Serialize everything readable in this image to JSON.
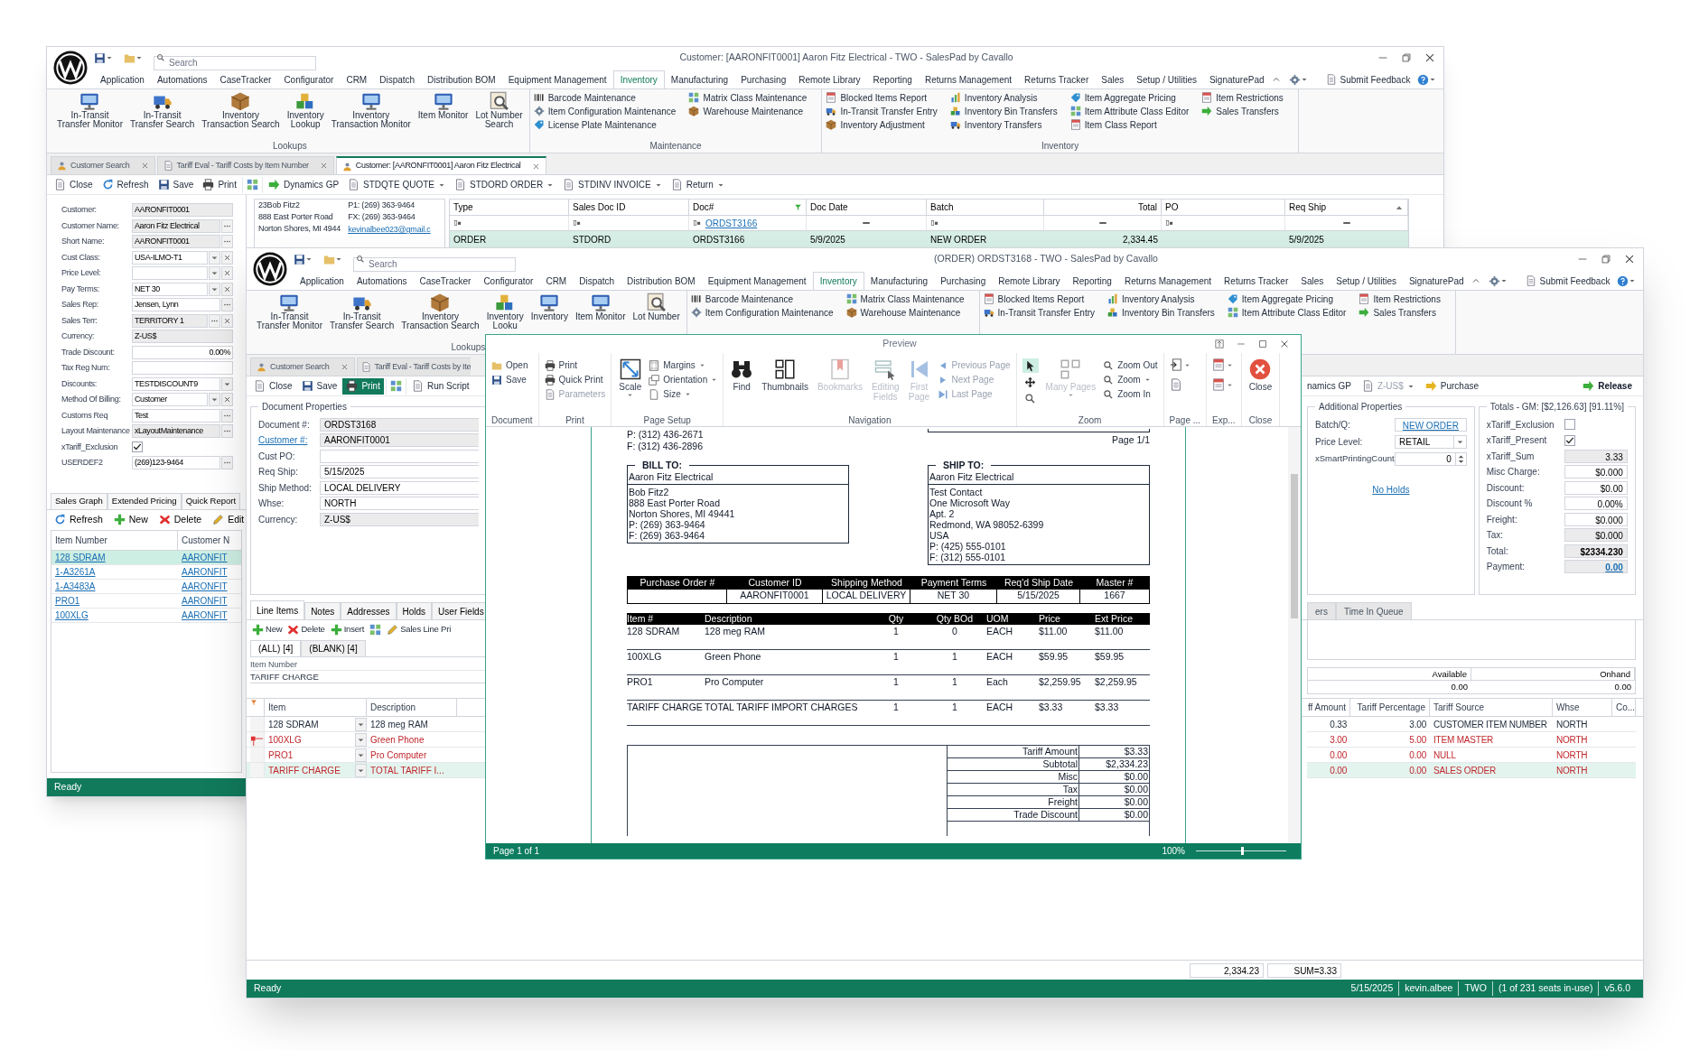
{
  "back_window": {
    "title": "Customer: [AARONFIT0001] Aaron Fitz Electrical - TWO - SalesPad by Cavallo",
    "search": {
      "placeholder": "Search"
    },
    "menu": [
      {
        "label": "Application",
        "selected": false
      },
      {
        "label": "Automations",
        "selected": false
      },
      {
        "label": "CaseTracker",
        "selected": false
      },
      {
        "label": "Configurator",
        "selected": false
      },
      {
        "label": "CRM",
        "selected": false
      },
      {
        "label": "Dispatch",
        "selected": false
      },
      {
        "label": "Distribution BOM",
        "selected": false
      },
      {
        "label": "Equipment Management",
        "selected": false
      },
      {
        "label": "Inventory",
        "selected": true
      },
      {
        "label": "Manufacturing",
        "selected": false
      },
      {
        "label": "Purchasing",
        "selected": false
      },
      {
        "label": "Remote Library",
        "selected": false
      },
      {
        "label": "Reporting",
        "selected": false
      },
      {
        "label": "Returns Management",
        "selected": false
      },
      {
        "label": "Returns Tracker",
        "selected": false
      },
      {
        "label": "Sales",
        "selected": false
      },
      {
        "label": "Setup / Utilities",
        "selected": false
      },
      {
        "label": "SignaturePad",
        "selected": false
      }
    ],
    "feedback": "Submit Feedback",
    "ribbon": [
      {
        "kind": "large",
        "label": "Lookups",
        "buttons": [
          [
            "In-Transit",
            "Transfer Monitor"
          ],
          [
            "In-Transit",
            "Transfer Search"
          ],
          [
            "Inventory",
            "Transaction Search"
          ],
          [
            "Inventory",
            "Lookup"
          ],
          [
            "Inventory",
            "Transaction Monitor"
          ],
          [
            "Item Monitor"
          ],
          [
            "Lot Number",
            "Search"
          ]
        ]
      },
      {
        "kind": "small",
        "label": "Maintenance",
        "columns": [
          [
            "Barcode Maintenance",
            "Item Configuration Maintenance",
            "License Plate Maintenance"
          ],
          [
            "Matrix Class Maintenance",
            "Warehouse Maintenance"
          ]
        ]
      },
      {
        "kind": "small",
        "label": "Inventory",
        "columns": [
          [
            "Blocked Items Report",
            "In-Transit Transfer Entry",
            "Inventory Adjustment"
          ],
          [
            "Inventory Analysis",
            "Inventory Bin Transfers",
            "Inventory Transfers"
          ],
          [
            "Item Aggregate Pricing",
            "Item Attribute Class Editor",
            "Item Class Report"
          ],
          [
            "Item Restrictions",
            "Sales Transfers"
          ]
        ]
      }
    ],
    "doc_tabs": [
      {
        "label": "Customer Search",
        "selected": false
      },
      {
        "label": "Tariff Eval - Tariff Costs by Item Number",
        "selected": false
      },
      {
        "label": "Customer: [AARONFIT0001] Aaron Fitz Electrical",
        "selected": true
      }
    ],
    "toolbar": {
      "left": [
        {
          "label": "Close",
          "kind": "button"
        },
        {
          "label": "Refresh",
          "kind": "button"
        },
        {
          "label": "Save",
          "kind": "button"
        },
        {
          "label": "Print",
          "kind": "button"
        },
        {
          "kind": "icon"
        },
        {
          "label": "Dynamics GP",
          "kind": "button"
        },
        {
          "label": "STDQTE QUOTE",
          "kind": "dropdown"
        },
        {
          "label": "STDORD ORDER",
          "kind": "dropdown"
        },
        {
          "label": "STDINV INVOICE",
          "kind": "dropdown"
        },
        {
          "label": "Return",
          "kind": "dropdown"
        }
      ]
    },
    "customer_form": [
      {
        "label": "Customer:",
        "value": "AARONFIT0001",
        "kind": "text",
        "readonly": true
      },
      {
        "label": "Customer Name:",
        "value": "Aaron Fitz Electrical",
        "kind": "lookup",
        "readonly": true
      },
      {
        "label": "Short Name:",
        "value": "AARONFIT0001",
        "kind": "lookup",
        "readonly": true
      },
      {
        "label": "Cust Class:",
        "value": "USA-ILMO-T1",
        "kind": "combo_clear",
        "readonly": false
      },
      {
        "label": "Price Level:",
        "kind": "combo_clear",
        "readonly": false
      },
      {
        "label": "Pay Terms:",
        "value": "NET 30",
        "kind": "combo_clear",
        "readonly": false
      },
      {
        "label": "Sales Rep:",
        "value": "Jensen, Lynn",
        "kind": "lookup",
        "readonly": false
      },
      {
        "label": "Sales Terr:",
        "value": "TERRITORY 1",
        "kind": "lookup_clear",
        "readonly": true
      },
      {
        "label": "Currency:",
        "value": "Z-US$",
        "kind": "text",
        "readonly": true
      },
      {
        "label": "Trade Discount:",
        "value": "0.00%",
        "kind": "number",
        "readonly": false
      },
      {
        "label": "Tax Reg Num:",
        "kind": "text",
        "readonly": false
      },
      {
        "label": "Discounts:",
        "value": "TESTDISCOUNT9",
        "kind": "combo",
        "readonly": false
      },
      {
        "label": "Method Of Billing:",
        "value": "Customer",
        "kind": "combo_clear",
        "readonly": false
      },
      {
        "label": "Customs Req",
        "value": "Test",
        "kind": "lookup",
        "readonly": false
      },
      {
        "label": "Layout Maintenance",
        "value": "xLayoutMaintenance",
        "kind": "lookup",
        "readonly": true
      },
      {
        "label": "xTariff_Exclusion",
        "kind": "checkbox",
        "checked": true
      },
      {
        "label": "USERDEF2",
        "value": "(269)123-9464",
        "kind": "lookup",
        "readonly": false
      }
    ],
    "address": {
      "lines": [
        "23Bob Fitz2",
        "888 East Porter Road",
        "Norton Shores, MI 4944"
      ],
      "phones": [
        "P1: (269) 363-9464",
        "FX: (269) 363-9464"
      ],
      "email": "kevinalbee023@gmail.c"
    },
    "orders_grid": {
      "columns": [
        "Type",
        "Sales Doc ID",
        "Doc#",
        "Doc Date",
        "Batch",
        "Total",
        "PO",
        "Req Ship"
      ],
      "filters": [
        {
          "kind": "contains"
        },
        {
          "kind": "contains"
        },
        {
          "kind": "contains",
          "value": "ORDST3166"
        },
        {
          "kind": "equals"
        },
        {
          "kind": "contains"
        },
        {
          "kind": "equals"
        },
        {
          "kind": "contains"
        },
        {
          "kind": "equals"
        }
      ],
      "rows": [
        {
          "type": "ORDER",
          "sales_doc_id": "STDORD",
          "doc": "ORDST3166",
          "doc_date": "5/9/2025",
          "batch": "NEW ORDER",
          "total": "2,334.45",
          "req_ship": "5/9/2025",
          "selected": true
        }
      ]
    },
    "side_tabs": [
      "Sales Graph",
      "Extended Pricing",
      "Quick Report"
    ],
    "side_toolbar": [
      "Refresh",
      "New",
      "Delete",
      "Edit"
    ],
    "item_list": {
      "columns": [
        "Item Number",
        "Customer N"
      ],
      "rows": [
        {
          "item": "128 SDRAM",
          "customer": "AARONFIT",
          "selected": true
        },
        {
          "item": "1-A3261A",
          "customer": "AARONFIT",
          "selected": false
        },
        {
          "item": "1-A3483A",
          "customer": "AARONFIT",
          "selected": false
        },
        {
          "item": "PRO1",
          "customer": "AARONFIT",
          "selected": false
        },
        {
          "item": "100XLG",
          "customer": "AARONFIT",
          "selected": false
        }
      ]
    },
    "status": "Ready"
  },
  "main_window": {
    "title": "(ORDER) ORDST3168 - TWO - SalesPad by Cavallo",
    "search": {
      "placeholder": "Search"
    },
    "menu": [
      {
        "label": "Application",
        "selected": false
      },
      {
        "label": "Automations",
        "selected": false
      },
      {
        "label": "CaseTracker",
        "selected": false
      },
      {
        "label": "Configurator",
        "selected": false
      },
      {
        "label": "CRM",
        "selected": false
      },
      {
        "label": "Dispatch",
        "selected": false
      },
      {
        "label": "Distribution BOM",
        "selected": false
      },
      {
        "label": "Equipment Management",
        "selected": false
      },
      {
        "label": "Inventory",
        "selected": true
      },
      {
        "label": "Manufacturing",
        "selected": false
      },
      {
        "label": "Purchasing",
        "selected": false
      },
      {
        "label": "Remote Library",
        "selected": false
      },
      {
        "label": "Reporting",
        "selected": false
      },
      {
        "label": "Returns Management",
        "selected": false
      },
      {
        "label": "Returns Tracker",
        "selected": false
      },
      {
        "label": "Sales",
        "selected": false
      },
      {
        "label": "Setup / Utilities",
        "selected": false
      },
      {
        "label": "SignaturePad",
        "selected": false
      }
    ],
    "feedback": "Submit Feedback",
    "ribbon": [
      {
        "kind": "large",
        "label": "Lookups",
        "buttons": [
          [
            "In-Transit",
            "Transfer Monitor"
          ],
          [
            "In-Transit",
            "Transfer Search"
          ],
          [
            "Inventory",
            "Transaction Search"
          ],
          [
            "Inventory",
            "Looku"
          ],
          [
            "Inventory"
          ],
          [
            "Item Monitor"
          ],
          [
            "Lot Number"
          ]
        ]
      },
      {
        "kind": "small",
        "columns": [
          [
            "Barcode Maintenance",
            "Item Configuration Maintenance"
          ],
          [
            "Matrix Class Maintenance",
            "Warehouse Maintenance"
          ]
        ]
      },
      {
        "kind": "small",
        "columns": [
          [
            "Blocked Items Report",
            "In-Transit Transfer Entry"
          ],
          [
            "Inventory Analysis",
            "Inventory Bin Transfers"
          ],
          [
            "Item Aggregate Pricing",
            "Item Attribute Class Editor"
          ],
          [
            "Item Restrictions",
            "Sales Transfers"
          ]
        ]
      }
    ],
    "doc_tabs": [
      {
        "label": "Customer Search",
        "selected": false
      },
      {
        "label": "Tariff Eval - Tariff Costs by Ite",
        "selected": false
      }
    ],
    "toolbar": {
      "left": [
        {
          "label": "Close",
          "kind": "button"
        },
        {
          "label": "Save",
          "kind": "button"
        },
        {
          "label": "Print",
          "kind": "primary"
        },
        {
          "kind": "icon"
        },
        {
          "label": "Run Script",
          "kind": "button"
        }
      ],
      "right": [
        {
          "label": "namics GP",
          "kind": "plain"
        },
        {
          "label": "Z-US$",
          "kind": "disabled_dropdown"
        },
        {
          "label": "Purchase",
          "kind": "button"
        },
        {
          "label": "Release",
          "kind": "strong"
        }
      ]
    },
    "doc_properties": {
      "title": "Document Properties",
      "fields": [
        {
          "label": "Document #:",
          "value": "ORDST3168",
          "readonly": true,
          "link": false
        },
        {
          "label": "Customer #:",
          "value": "AARONFIT0001",
          "readonly": true,
          "link": true
        },
        {
          "label": "Cust PO:",
          "readonly": false,
          "link": false
        },
        {
          "label": "Req Ship:",
          "value": "5/15/2025",
          "readonly": false,
          "link": false
        },
        {
          "label": "Ship Method:",
          "value": "LOCAL DELIVERY",
          "readonly": false,
          "link": false
        },
        {
          "label": "Whse:",
          "value": "NORTH",
          "readonly": false,
          "link": false
        },
        {
          "label": "Currency:",
          "value": "Z-US$",
          "readonly": true,
          "link": false
        }
      ]
    },
    "additional_properties": {
      "title": "Additional Properties",
      "batch": {
        "label": "Batch/Q:",
        "value": "NEW ORDER"
      },
      "price_level": {
        "label": "Price Level:",
        "value": "RETAIL"
      },
      "printing_count": {
        "label": "xSmartPrintingCount",
        "value": "0"
      },
      "holds": "No Holds"
    },
    "totals": {
      "title": "Totals - GM: [$2,126.63] [91.11%]",
      "rows": [
        {
          "label": "xTariff_Exclusion",
          "kind": "checkbox",
          "checked": false
        },
        {
          "label": "xTariff_Present",
          "kind": "checkbox",
          "checked": true
        },
        {
          "label": "xTariff_Sum",
          "value": "3.33",
          "kind": "readonly"
        },
        {
          "label": "Misc Charge:",
          "value": "$0.000",
          "kind": "input"
        },
        {
          "label": "Discount:",
          "value": "$0.00",
          "kind": "input"
        },
        {
          "label": "Discount %",
          "value": "0.00%",
          "kind": "input"
        },
        {
          "label": "Freight:",
          "value": "$0.000",
          "kind": "input"
        },
        {
          "label": "Tax:",
          "value": "$0.000",
          "kind": "readonly"
        },
        {
          "label": "Total:",
          "value": "$2334.230",
          "kind": "total"
        },
        {
          "label": "Payment:",
          "value": "0.00",
          "kind": "link"
        }
      ]
    },
    "line_tabs": {
      "left": [
        {
          "label": "Line Items",
          "selected": true
        },
        {
          "label": "Notes",
          "selected": false
        },
        {
          "label": "Addresses",
          "selected": false
        },
        {
          "label": "Holds",
          "selected": false
        },
        {
          "label": "User Fields",
          "selected": false
        }
      ],
      "right": [
        {
          "label": "ers",
          "selected": false
        },
        {
          "label": "Time In Queue",
          "selected": false
        }
      ]
    },
    "line_toolbar": [
      {
        "label": "New",
        "kind": "button"
      },
      {
        "label": "Delete",
        "kind": "button"
      },
      {
        "label": "Insert",
        "kind": "button"
      },
      {
        "kind": "icon"
      },
      {
        "label": "Sales Line Pri",
        "kind": "button"
      }
    ],
    "filter_tabs": [
      {
        "label": "(ALL) [4]",
        "selected": true
      },
      {
        "label": "(BLANK) [4]",
        "selected": false
      }
    ],
    "item_number": {
      "label": "Item Number",
      "value": "TARIFF CHARGE"
    },
    "availability": {
      "columns": [
        "Available",
        "Onhand"
      ],
      "values": [
        "0.00",
        "0.00"
      ]
    },
    "lines": {
      "columns_left": [
        "Item",
        "Description"
      ],
      "columns_right": [
        "ff Amount",
        "Tariff Percentage",
        "Tariff Source",
        "Whse",
        "Co..."
      ],
      "rows": [
        {
          "item": "128 SDRAM",
          "description": "128 meg RAM",
          "tariff_amount": "0.33",
          "tariff_percentage": "3.00",
          "tariff_source": "CUSTOMER ITEM NUMBER",
          "whse": "NORTH",
          "flagged": false,
          "focused": false,
          "selected": false
        },
        {
          "item": "100XLG",
          "description": "Green Phone",
          "tariff_amount": "3.00",
          "tariff_percentage": "5.00",
          "tariff_source": "ITEM MASTER",
          "whse": "NORTH",
          "flagged": true,
          "focused": true,
          "selected": false
        },
        {
          "item": "PRO1",
          "description": "Pro Computer",
          "tariff_amount": "0.00",
          "tariff_percentage": "0.00",
          "tariff_source": "NULL",
          "whse": "NORTH",
          "flagged": true,
          "focused": false,
          "selected": false
        },
        {
          "item": "TARIFF CHARGE",
          "description": "TOTAL TARIFF I...",
          "tariff_amount": "0.00",
          "tariff_percentage": "0.00",
          "tariff_source": "SALES ORDER",
          "whse": "NORTH",
          "flagged": true,
          "focused": false,
          "selected": true
        }
      ]
    },
    "summary": [
      "2,334.23",
      "SUM=3.33"
    ],
    "status": {
      "left": "Ready",
      "right": [
        "5/15/2025",
        "kevin.albee",
        "TWO",
        "(1 of 231 seats in-use)",
        "v5.6.0"
      ]
    }
  },
  "preview": {
    "title": "Preview",
    "ribbon": [
      {
        "label": "Document",
        "items": [
          {
            "label": "Open",
            "disabled": false,
            "dropdown": false
          },
          {
            "label": "Save",
            "disabled": false,
            "dropdown": false
          }
        ]
      },
      {
        "label": "Print",
        "items": [
          {
            "label": "Print",
            "disabled": false,
            "dropdown": false
          },
          {
            "label": "Quick Print",
            "disabled": false,
            "dropdown": false
          },
          {
            "label": "Parameters",
            "disabled": true,
            "dropdown": false
          }
        ]
      },
      {
        "label": "Page Setup",
        "large": [
          {
            "lines": [
              "Scale"
            ],
            "disabled": false,
            "dropdown": true
          }
        ],
        "items": [
          {
            "label": "Margins",
            "disabled": false,
            "dropdown": true
          },
          {
            "label": "Orientation",
            "disabled": false,
            "dropdown": true
          },
          {
            "label": "Size",
            "disabled": false,
            "dropdown": true
          }
        ]
      },
      {
        "label": "Navigation",
        "large": [
          {
            "lines": [
              "Find"
            ],
            "disabled": false,
            "dropdown": false
          },
          {
            "lines": [
              "Thumbnails"
            ],
            "disabled": false,
            "dropdown": false
          },
          {
            "lines": [
              "Bookmarks"
            ],
            "disabled": true,
            "dropdown": false
          },
          {
            "lines": [
              "Editing",
              "Fields"
            ],
            "disabled": true,
            "dropdown": false
          },
          {
            "lines": [
              "First",
              "Page"
            ],
            "disabled": true,
            "dropdown": false
          }
        ],
        "items": [
          {
            "label": "Previous Page",
            "disabled": true,
            "dropdown": false
          },
          {
            "label": "Next Page",
            "disabled": true,
            "dropdown": false
          },
          {
            "label": "Last Page",
            "disabled": true,
            "dropdown": false
          }
        ]
      },
      {
        "label": "Zoom",
        "tools": [
          {
            "selected": true
          },
          {
            "selected": false
          },
          {
            "selected": false
          }
        ],
        "large": [
          {
            "lines": [
              "Many Pages"
            ],
            "disabled": true,
            "dropdown": true
          }
        ],
        "items": [
          {
            "label": "Zoom Out",
            "disabled": false,
            "dropdown": false
          },
          {
            "label": "Zoom",
            "disabled": false,
            "dropdown": true
          },
          {
            "label": "Zoom In",
            "disabled": false,
            "dropdown": false
          }
        ]
      },
      {
        "label": "Page ...",
        "icon_buttons": [
          {
            "dropdown": true
          },
          {
            "dropdown": false
          }
        ]
      },
      {
        "label": "Exp...",
        "icon_buttons": [
          {
            "dropdown": true
          },
          {
            "dropdown": true
          }
        ]
      },
      {
        "label": "Close",
        "large": [
          {
            "lines": [
              "Close"
            ],
            "disabled": false,
            "dropdown": false
          }
        ]
      }
    ],
    "document": {
      "top_lines": [
        "P: (312) 436-2671",
        "F: (312) 436-2896"
      ],
      "page_label": "Page 1/1",
      "bill_to": {
        "title": "BILL TO:",
        "name": "Aaron Fitz Electrical",
        "lines": [
          "Bob Fitz2",
          "888 East Porter Road",
          "Norton Shores, MI 49441",
          "P: (269) 363-9464",
          "F: (269) 363-9464"
        ]
      },
      "ship_to": {
        "title": "SHIP TO:",
        "name": "Aaron Fitz Electrical",
        "lines": [
          "Test Contact",
          "One Microsoft Way",
          "Apt. 2",
          "Redmond, WA 98052-6399",
          "USA",
          "P: (425) 555-0101",
          "F: (312) 555-0101"
        ]
      },
      "order_header": [
        {
          "label": "Purchase Order #"
        },
        {
          "label": "Customer ID",
          "value": "AARONFIT0001"
        },
        {
          "label": "Shipping Method",
          "value": "LOCAL DELIVERY"
        },
        {
          "label": "Payment Terms",
          "value": "NET 30"
        },
        {
          "label": "Req'd Ship Date",
          "value": "5/15/2025"
        },
        {
          "label": "Master #",
          "value": "1667"
        }
      ],
      "items": {
        "columns": [
          "Item #",
          "Description",
          "Qty",
          "Qty BOd",
          "UOM",
          "Price",
          "Ext Price"
        ],
        "rows": [
          [
            "128 SDRAM",
            "128 meg RAM",
            "1",
            "0",
            "EACH",
            "$11.00",
            "$11.00"
          ],
          [
            "100XLG",
            "Green Phone",
            "1",
            "1",
            "EACH",
            "$59.95",
            "$59.95"
          ],
          [
            "PRO1",
            "Pro Computer",
            "1",
            "1",
            "Each",
            "$2,259.95",
            "$2,259.95"
          ],
          [
            "TARIFF CHARGE",
            "TOTAL TARIFF IMPORT CHARGES",
            "1",
            "1",
            "EACH",
            "$3.33",
            "$3.33"
          ]
        ]
      },
      "totals": [
        {
          "label": "Tariff Amount",
          "value": "$3.33"
        },
        {
          "label": "Subtotal",
          "value": "$2,334.23"
        },
        {
          "label": "Misc",
          "value": "$0.00"
        },
        {
          "label": "Tax",
          "value": "$0.00"
        },
        {
          "label": "Freight",
          "value": "$0.00"
        },
        {
          "label": "Trade Discount",
          "value": "$0.00"
        }
      ]
    },
    "status": {
      "page": "Page 1 of 1",
      "zoom": "100%",
      "zoom_slider": {
        "level": 0.5
      }
    }
  }
}
